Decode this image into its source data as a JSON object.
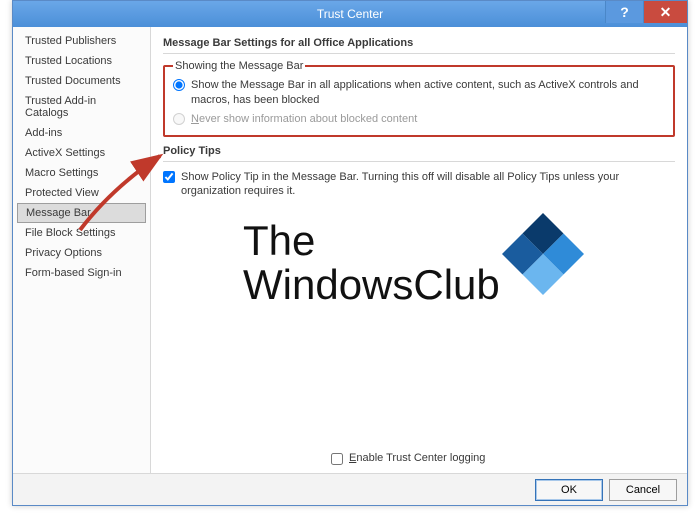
{
  "title": "Trust Center",
  "sidebar": {
    "items": [
      {
        "label": "Trusted Publishers"
      },
      {
        "label": "Trusted Locations"
      },
      {
        "label": "Trusted Documents"
      },
      {
        "label": "Trusted Add-in Catalogs"
      },
      {
        "label": "Add-ins"
      },
      {
        "label": "ActiveX Settings"
      },
      {
        "label": "Macro Settings"
      },
      {
        "label": "Protected View"
      },
      {
        "label": "Message Bar"
      },
      {
        "label": "File Block Settings"
      },
      {
        "label": "Privacy Options"
      },
      {
        "label": "Form-based Sign-in"
      }
    ],
    "selected_index": 8
  },
  "content": {
    "header": "Message Bar Settings for all Office Applications",
    "group_legend": "Showing the Message Bar",
    "radio1": "Show the Message Bar in all applications when active content, such as ActiveX controls and macros, has been blocked",
    "radio2_pre": "",
    "radio2_char": "N",
    "radio2_post": "ever show information about blocked content",
    "policy_header": "Policy Tips",
    "policy_text": "Show Policy Tip in the Message Bar. Turning this off will disable all Policy Tips unless your organization requires it.",
    "enable_logging_pre": "",
    "enable_logging_char": "E",
    "enable_logging_post": "nable Trust Center logging"
  },
  "watermark": {
    "line1": "The",
    "line2": "WindowsClub"
  },
  "footer": {
    "ok": "OK",
    "cancel": "Cancel"
  },
  "titlebar": {
    "help": "?",
    "close": "✕"
  }
}
